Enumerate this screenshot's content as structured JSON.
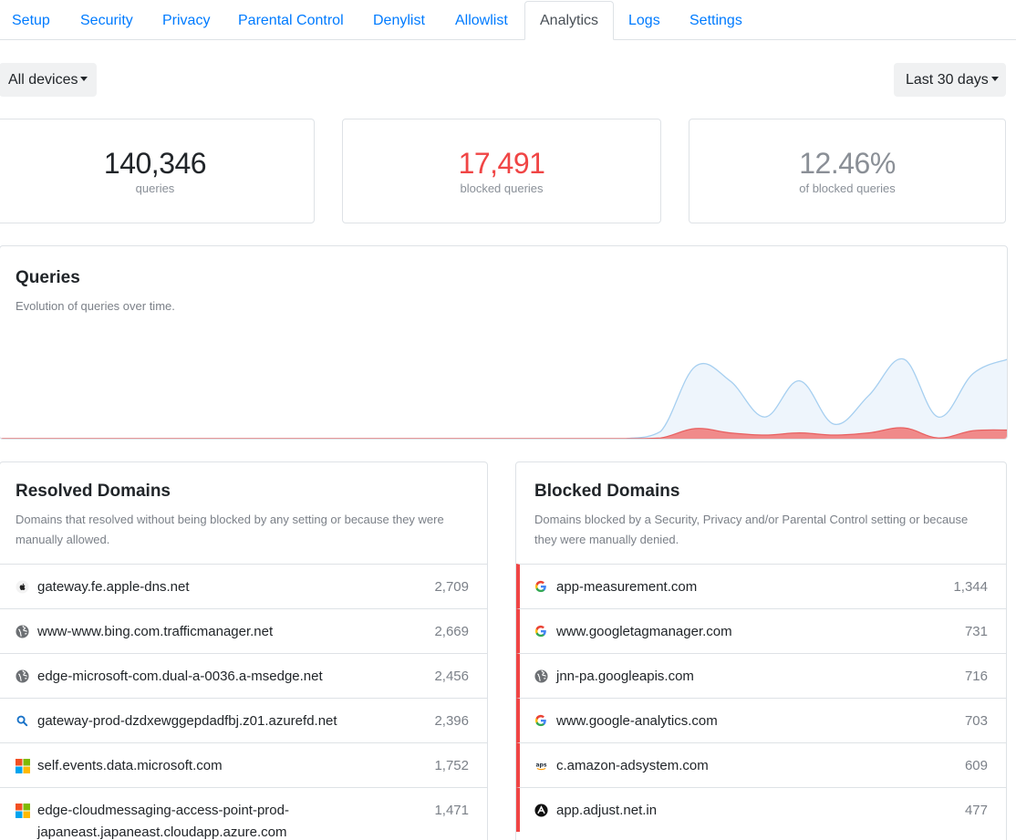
{
  "tabs": [
    {
      "label": "Setup"
    },
    {
      "label": "Security"
    },
    {
      "label": "Privacy"
    },
    {
      "label": "Parental Control"
    },
    {
      "label": "Denylist"
    },
    {
      "label": "Allowlist"
    },
    {
      "label": "Analytics",
      "active": true
    },
    {
      "label": "Logs"
    },
    {
      "label": "Settings"
    }
  ],
  "filters": {
    "devices": "All devices",
    "range": "Last 30 days"
  },
  "stats": {
    "queries": {
      "value": "140,346",
      "label": "queries",
      "color": "#212529"
    },
    "blocked": {
      "value": "17,491",
      "label": "blocked queries",
      "color": "#f04545"
    },
    "percent": {
      "value": "12.46%",
      "label": "of blocked queries",
      "color": "#8a8f96"
    }
  },
  "queries_panel": {
    "title": "Queries",
    "subtitle": "Evolution of queries over time."
  },
  "chart_data": {
    "type": "area",
    "title": "Queries",
    "x_count": 30,
    "series": [
      {
        "color": "#a6cff0",
        "values": [
          0,
          0,
          0,
          0,
          0,
          0,
          0,
          0,
          0,
          0,
          0,
          0,
          0,
          0,
          0,
          0,
          0,
          0,
          0,
          1,
          10,
          8,
          3,
          8,
          2,
          6,
          11,
          3,
          9,
          11
        ]
      },
      {
        "color": "#f08a8a",
        "values": [
          0,
          0,
          0,
          0,
          0,
          0,
          0,
          0,
          0,
          0,
          0,
          0,
          0,
          0,
          0,
          0,
          0,
          0,
          0,
          0.1,
          1.4,
          0.8,
          0.5,
          0.8,
          0.5,
          0.8,
          1.5,
          0.1,
          1.1,
          1.2
        ]
      }
    ],
    "ylim": [
      0,
      14
    ],
    "grid": false
  },
  "resolved": {
    "title": "Resolved Domains",
    "subtitle": "Domains that resolved without being blocked by any setting or because they were manually allowed.",
    "items": [
      {
        "domain": "gateway.fe.apple-dns.net",
        "count": "2,709",
        "icon": "apple-icon"
      },
      {
        "domain": "www-www.bing.com.trafficmanager.net",
        "count": "2,669",
        "icon": "globe-icon"
      },
      {
        "domain": "edge-microsoft-com.dual-a-0036.a-msedge.net",
        "count": "2,456",
        "icon": "globe-icon"
      },
      {
        "domain": "gateway-prod-dzdxewggepdadfbj.z01.azurefd.net",
        "count": "2,396",
        "icon": "search-icon"
      },
      {
        "domain": "self.events.data.microsoft.com",
        "count": "1,752",
        "icon": "microsoft-icon"
      },
      {
        "domain": "edge-cloudmessaging-access-point-prod-japaneast.japaneast.cloudapp.azure.com",
        "count": "1,471",
        "icon": "microsoft-icon"
      }
    ]
  },
  "blocked": {
    "title": "Blocked Domains",
    "subtitle": "Domains blocked by a Security, Privacy and/or Parental Control setting or because they were manually denied.",
    "items": [
      {
        "domain": "app-measurement.com",
        "count": "1,344",
        "icon": "google-icon"
      },
      {
        "domain": "www.googletagmanager.com",
        "count": "731",
        "icon": "google-icon"
      },
      {
        "domain": "jnn-pa.googleapis.com",
        "count": "716",
        "icon": "globe-icon"
      },
      {
        "domain": "www.google-analytics.com",
        "count": "703",
        "icon": "google-icon"
      },
      {
        "domain": "c.amazon-adsystem.com",
        "count": "609",
        "icon": "amazon-ads-icon",
        "icon_text": "aps"
      },
      {
        "domain": "app.adjust.net.in",
        "count": "477",
        "icon": "adjust-icon"
      }
    ]
  }
}
